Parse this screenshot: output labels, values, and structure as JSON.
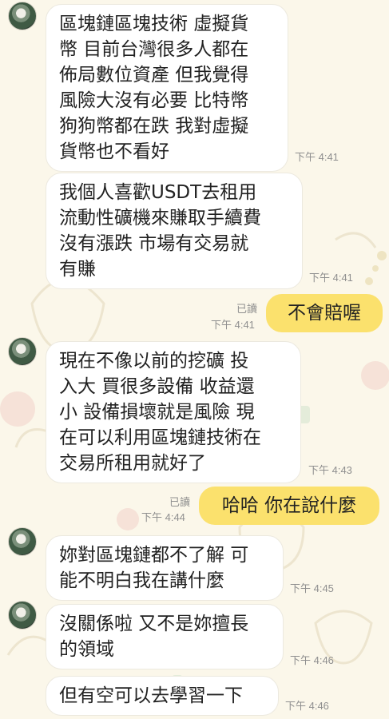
{
  "messages": [
    {
      "direction": "in",
      "text": "區塊鏈區塊技術 虛擬貨\n幣 目前台灣很多人都在\n佈局數位資產 但我覺得\n風險大沒有必要 比特幣\n狗狗幣都在跌 我對虛擬\n貨幣也不看好",
      "time": "下午 4:41"
    },
    {
      "direction": "in",
      "text": "我個人喜歡USDT去租用\n流動性礦機來賺取手續費\n沒有漲跌 市場有交易就\n有賺",
      "time": "下午 4:41"
    },
    {
      "direction": "out",
      "text": "不會賠喔",
      "read": "已讀",
      "time": "下午 4:41"
    },
    {
      "direction": "in",
      "text": "現在不像以前的挖礦 投\n入大 買很多設備 收益還\n小 設備損壞就是風險 現\n在可以利用區塊鏈技術在\n交易所租用就好了",
      "time": "下午 4:43"
    },
    {
      "direction": "out",
      "text": "哈哈 你在說什麼",
      "read": "已讀",
      "time": "下午 4:44"
    },
    {
      "direction": "in",
      "text": "妳對區塊鏈都不了解 可\n能不明白我在講什麼",
      "time": "下午 4:45"
    },
    {
      "direction": "in",
      "text": "沒關係啦 又不是妳擅長\n的領域",
      "time": "下午 4:46"
    },
    {
      "direction": "in",
      "text": "但有空可以去學習一下",
      "time": "下午 4:46"
    }
  ]
}
